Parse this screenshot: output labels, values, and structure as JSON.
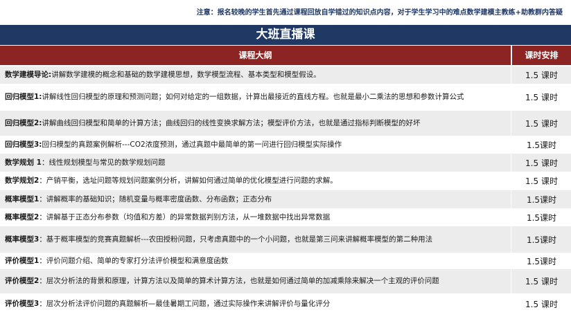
{
  "notice": "注意：报名较晚的学生首先通过课程回放自学错过的知识点内容，对于学生学习中的难点数学建模主教练+助教群内答疑",
  "banner_title": "大班直播课",
  "table": {
    "header_outline": "课程大纲",
    "header_hours": "课时安排",
    "rows": [
      {
        "title": "数学建模导论:",
        "desc": "讲解数学建模的概念和基础的数学建模思想，数学模型流程、基本类型和模型假设。",
        "hours": "1.5 课时"
      },
      {
        "title": "回归模型1:",
        "desc": "讲解线性回归模型的原理和预测问题；如何对给定的一组数据，计算出最接近的直线方程。也就是最小二乘法的思想和参数计算公式",
        "hours": "1.5 课时"
      },
      {
        "title": "回归模型2:",
        "desc": "讲解曲线回归模型和简单的计算方法；曲线回归的线性变换求解方法；模型评价方法，也就是通过指标判断模型的好坏",
        "hours": "1.5 课时"
      },
      {
        "title": "回归模型3:",
        "desc": "回归模型的真题案例解析---CO2浓度预测，通过真题中最简单的第一问进行回归模型实际操作",
        "hours": "1.5课时"
      },
      {
        "title": "数学规划 1",
        "desc": "：线性规划模型与常见的数学规划问题",
        "hours": "1.5 课时"
      },
      {
        "title": "数学规划2",
        "desc": "：产销平衡，选址问题等规划问题案例分析，讲解如何通过简单的优化模型进行问题的求解。",
        "hours": "1.5 课时"
      },
      {
        "title": "概率模型1",
        "desc": "：讲解概率的基础知识；随机变量与概率密度函数、分布函数；正态分布",
        "hours": "1.5课时"
      },
      {
        "title": "概率模型2",
        "desc": "：讲解基于正态分布参数（均值和方差）的异常数据判别方法，从一堆数据中找出异常数据",
        "hours": "1.5课时"
      },
      {
        "title": "概率模型3",
        "desc": "：基于概率模型的竞赛真题解析---农田授粉问题，只考虑真题中的一个小问题，也就是第三问来讲解概率模型的第二种用法",
        "hours": "1.5课时"
      },
      {
        "title": "评价模型1",
        "desc": "：评价问题介绍、简单的专家打分法评价模型和满意度函数",
        "hours": "1.5课时"
      },
      {
        "title": "评价模型2",
        "desc": "：层次分析法的背景和原理，计算方法以及简单的算术计算方法，也就是如何通过简单的加减乘除来解决一个主观的评价问题",
        "hours": "1.5 课时"
      },
      {
        "title": "评价模型3",
        "desc": "：层次分析法评价问题的真题解析—最佳暑期工问题，通过实际操作来讲解评价与量化评分",
        "hours": "1.5 课时"
      }
    ]
  }
}
